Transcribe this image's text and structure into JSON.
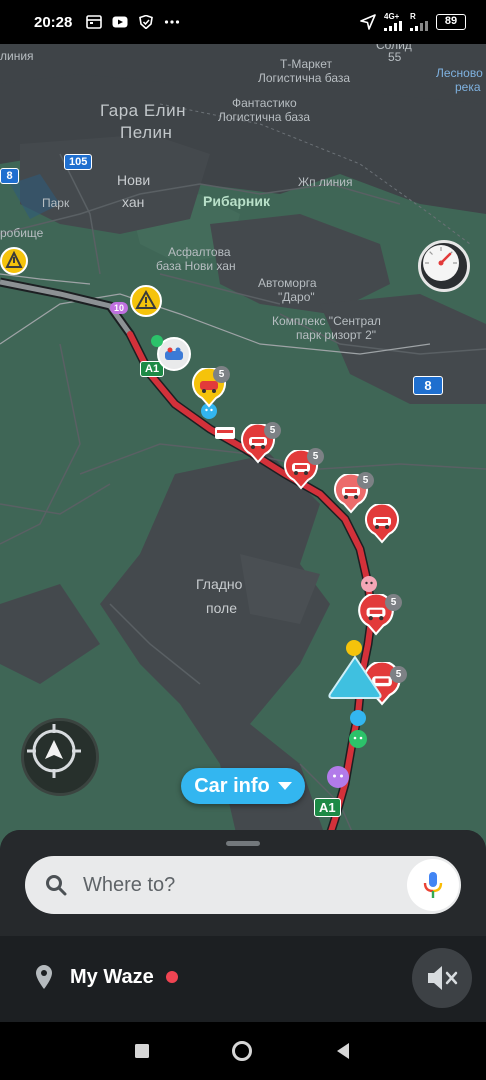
{
  "status_bar": {
    "time": "20:28",
    "network_label": "4G+",
    "sim2_label": "R",
    "battery": "89",
    "icons": [
      "calendar-icon",
      "youtube-icon",
      "shield-icon",
      "more-icon",
      "location-arrow-icon",
      "signal-icon",
      "battery-icon"
    ]
  },
  "map": {
    "labels": {
      "top_left_fragment": "линия",
      "solid": "Солид",
      "solid_number": "55",
      "t_market_1": "Т-Маркет",
      "t_market_2": "Логистична база",
      "lesnovo_1": "Лесново",
      "lesnovo_2": "река",
      "gara_1": "Гара Елин",
      "gara_2": "Пелин",
      "fantastiko_1": "Фантастико",
      "fantastiko_2": "Логистична база",
      "novi_1": "Нови",
      "novi_2": "хан",
      "park": "Парк",
      "zhp_liniya": "Жп линия",
      "ribarnik": "Рибарник",
      "grobishte": "робище",
      "asfaltova_1": "Асфалтова",
      "asfaltova_2": "база Нови хан",
      "avtomorga_1": "Автоморга",
      "avtomorga_2": "\"Даро\"",
      "kompleks_1": "Комплекс \"Сентрал",
      "kompleks_2": "парк ризорт 2\"",
      "gladno_1": "Гладно",
      "gladno_2": "поле"
    },
    "shields": {
      "road_105": "105",
      "road_8_left": "8",
      "road_8_right": "8",
      "a1_top": "A1",
      "a1_bottom": "A1"
    },
    "report_counts": [
      "5",
      "5",
      "5",
      "5",
      "5",
      "5"
    ],
    "small_badge": "10"
  },
  "car_info": {
    "label": "Car info"
  },
  "search": {
    "placeholder": "Where to?"
  },
  "my_waze": {
    "label": "My Waze"
  },
  "colors": {
    "route": "#d3313a",
    "traffic_badge": "#e23a3a",
    "hazard": "#f5c30b",
    "car_info": "#33b6f0",
    "map_green": "#3f6656",
    "map_gray": "#3f4448"
  }
}
